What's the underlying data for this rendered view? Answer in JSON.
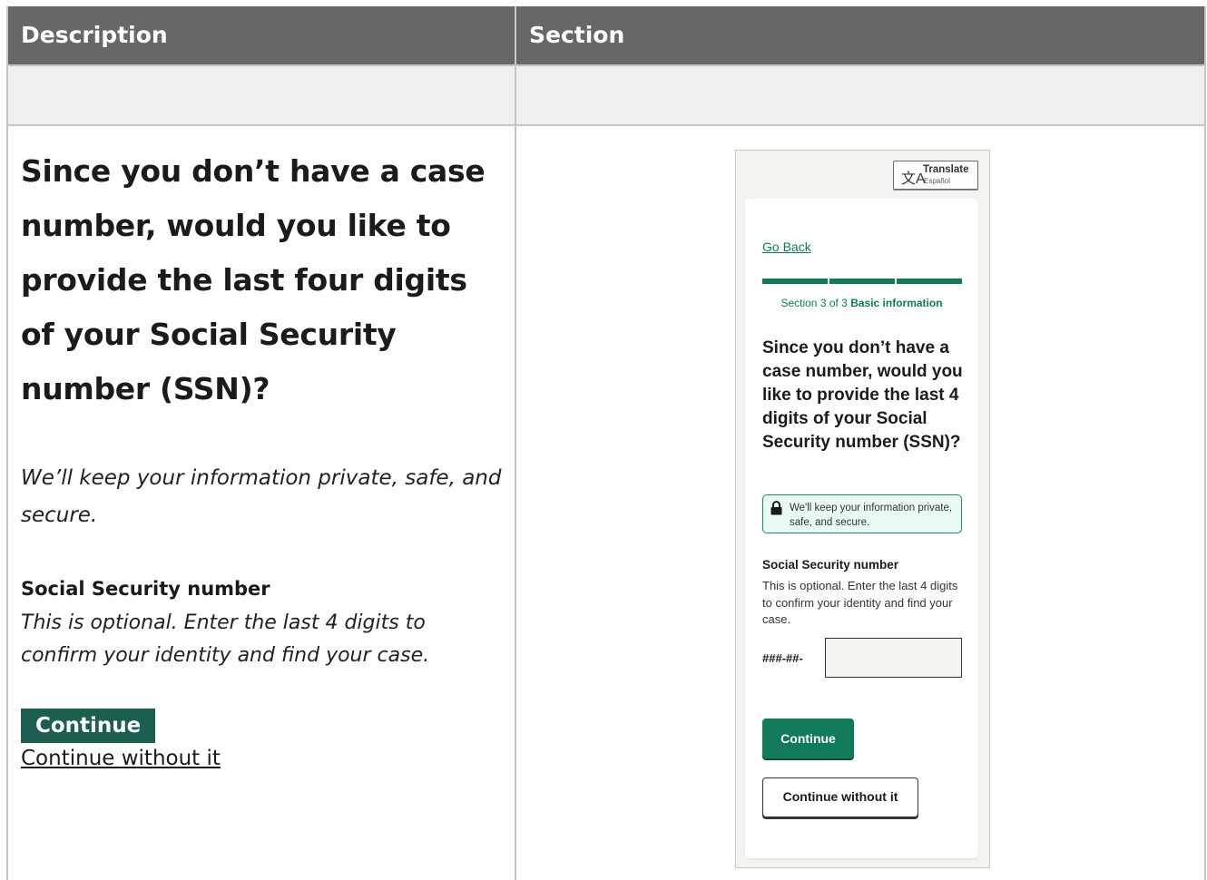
{
  "table": {
    "headers": [
      "Description",
      "Section"
    ]
  },
  "description": {
    "title": "Since you don’t have a case number, would you like to provide the last four digits of your Social Security number (SSN)?",
    "privacy_note": "We’ll keep your information private, safe, and secure.",
    "field_label": "Social Security number",
    "field_hint": "This is optional. Enter the last 4 digits to confirm your identity and find your case.",
    "continue_label": "Continue",
    "continue_without_label": "Continue without it"
  },
  "mockup": {
    "translate": {
      "label": "Translate",
      "sublabel": "Español"
    },
    "go_back": "Go Back",
    "progress": {
      "current": 3,
      "total": 3
    },
    "section_prefix": "Section 3 of 3",
    "section_name": "Basic information",
    "title": "Since you don’t have a case number, would you like to provide the last 4 digits of your Social Security number (SSN)?",
    "privacy_note": "We'll keep your information private, safe, and secure.",
    "field_label": "Social Security number",
    "field_hint": "This is optional. Enter the last 4 digits to confirm your identity and find your case.",
    "ssn_prefix": "###-##-",
    "ssn_value": "",
    "continue_label": "Continue",
    "continue_without_label": "Continue without it",
    "icons": {
      "translate": "translate-icon",
      "lock": "lock-icon"
    },
    "accent_color": "#127a5a"
  }
}
